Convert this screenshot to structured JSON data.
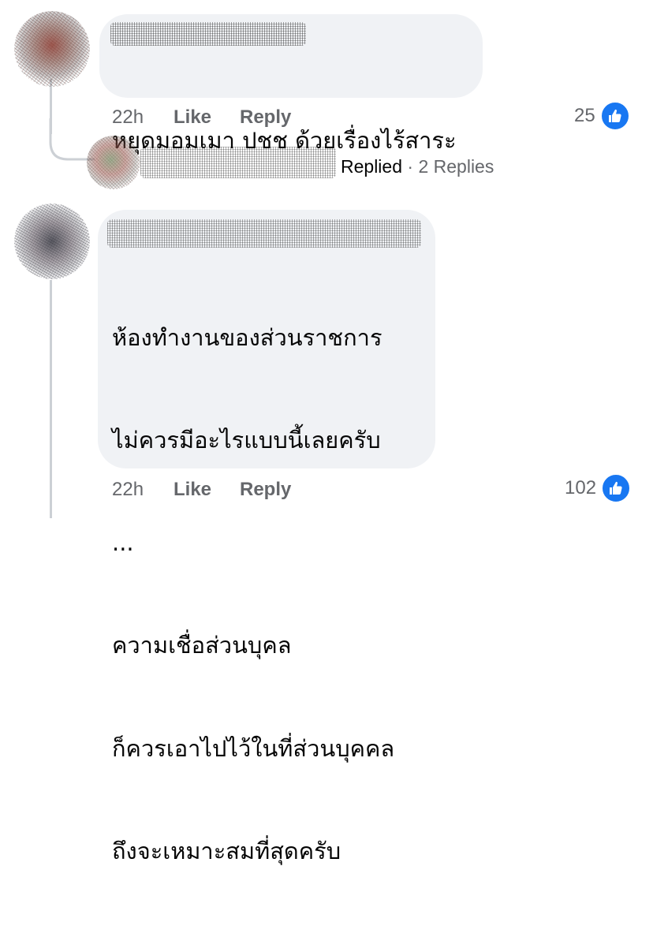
{
  "comments": [
    {
      "text_lines": [
        "หยุดมอมเมา ปชช ด้วยเรื่องไร้สาระ"
      ],
      "time": "22h",
      "like_label": "Like",
      "reply_label": "Reply",
      "reaction_count": "25",
      "reaction_icon": "like-thumb-icon",
      "reply_summary": {
        "replied_label": "Replied",
        "separator": " · ",
        "count_label": "2 Replies"
      }
    },
    {
      "text_lines": [
        "ห้องทำงานของส่วนราชการ",
        "ไม่ควรมีอะไรแบบนี้เลยครับ",
        "...",
        "ความเชื่อส่วนบุคล",
        "ก็ควรเอาไปไว้ในที่ส่วนบุคคล",
        "ถึงจะเหมาะสมที่สุดครับ"
      ],
      "time": "22h",
      "like_label": "Like",
      "reply_label": "Reply",
      "reaction_count": "102",
      "reaction_icon": "like-thumb-icon"
    }
  ],
  "colors": {
    "bubble": "#f0f2f5",
    "meta_text": "#65676b",
    "like_blue": "#1877f2",
    "thread_line": "#ccd0d5"
  }
}
